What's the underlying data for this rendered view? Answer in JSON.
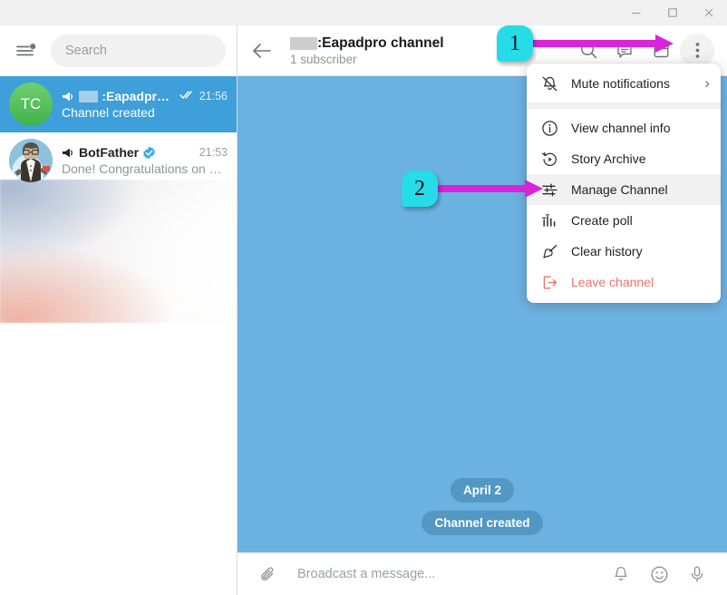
{
  "window": {
    "minimize_label": "Minimize",
    "maximize_label": "Maximize",
    "close_label": "Close"
  },
  "sidebar": {
    "menu_icon": "hamburger-menu-icon",
    "search": {
      "placeholder": "Search",
      "value": ""
    },
    "chats": [
      {
        "avatar_initials": "TC",
        "title": ":Eapadpro c...",
        "title_redacted": true,
        "muted_icon": "megaphone-muted-icon",
        "read_status": "read-checks-icon",
        "time": "21:56",
        "preview": "Channel created",
        "active": true,
        "verified": false
      },
      {
        "avatar_initials": "",
        "title": "BotFather",
        "title_redacted": false,
        "muted_icon": "megaphone-muted-icon",
        "read_status": "",
        "time": "21:53",
        "preview": "Done! Congratulations on yo...",
        "active": false,
        "verified": true
      }
    ]
  },
  "chat_header": {
    "back_label": "Back",
    "title": ":Eapadpro channel",
    "subtitle": "1 subscriber",
    "actions": [
      {
        "name": "search-icon",
        "label": "Search"
      },
      {
        "name": "comments-icon",
        "label": "Comments"
      },
      {
        "name": "calendar-icon",
        "label": "Calendar"
      },
      {
        "name": "more-vertical-icon",
        "label": "More"
      }
    ]
  },
  "messages": {
    "date_pill": "April 2",
    "service_pill": "Channel created"
  },
  "composer": {
    "attach_label": "Attach",
    "placeholder": "Broadcast a message...",
    "bell_label": "Silent broadcast",
    "emoji_label": "Emoji",
    "mic_label": "Record voice"
  },
  "menu": {
    "items": [
      {
        "icon": "mute-bell-icon",
        "label": "Mute notifications",
        "submenu": true,
        "chevron": "›",
        "danger": false,
        "highlighted": false
      },
      {
        "icon": "info-circle-icon",
        "label": "View channel info",
        "submenu": false,
        "chevron": "",
        "danger": false,
        "highlighted": false
      },
      {
        "icon": "story-archive-icon",
        "label": "Story Archive",
        "submenu": false,
        "chevron": "",
        "danger": false,
        "highlighted": false
      },
      {
        "icon": "sliders-icon",
        "label": "Manage Channel",
        "submenu": false,
        "chevron": "",
        "danger": false,
        "highlighted": true
      },
      {
        "icon": "poll-bars-icon",
        "label": "Create poll",
        "submenu": false,
        "chevron": "",
        "danger": false,
        "highlighted": false
      },
      {
        "icon": "broom-icon",
        "label": "Clear history",
        "submenu": false,
        "chevron": "",
        "danger": false,
        "highlighted": false
      },
      {
        "icon": "leave-arrow-icon",
        "label": "Leave channel",
        "submenu": false,
        "chevron": "",
        "danger": true,
        "highlighted": false
      }
    ]
  },
  "annotations": {
    "step1": "1",
    "step2": "2",
    "arrow_color": "#d924d9",
    "badge_color": "#25dce8"
  },
  "theme": {
    "chat_background": "#6cb2e0",
    "active_row": "#3e9fda",
    "danger": "#e8736a",
    "verified_blue": "#3aaee0"
  }
}
